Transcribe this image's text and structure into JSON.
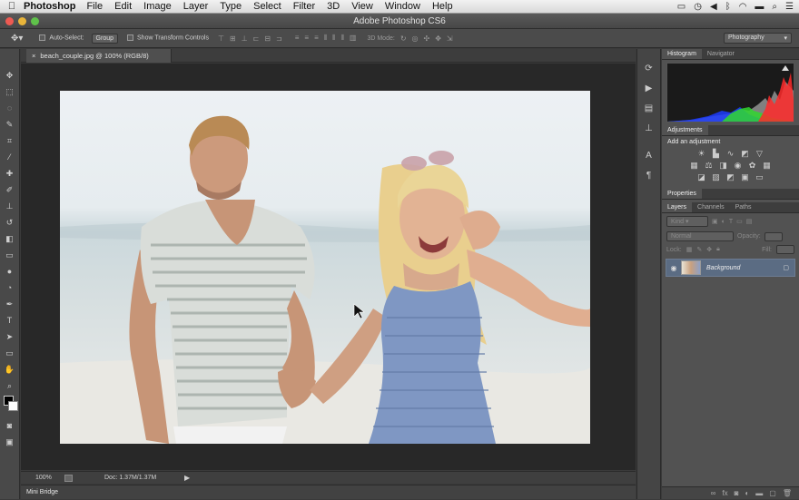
{
  "menubar": {
    "app": "Photoshop",
    "items": [
      "File",
      "Edit",
      "Image",
      "Layer",
      "Type",
      "Select",
      "Filter",
      "3D",
      "View",
      "Window",
      "Help"
    ]
  },
  "window": {
    "title": "Adobe Photoshop CS6"
  },
  "options": {
    "auto_select": "Auto-Select:",
    "group": "Group",
    "show_transform": "Show Transform Controls",
    "mode_3d": "3D Mode:",
    "workspace": "Photography"
  },
  "document": {
    "tab": "beach_couple.jpg @ 100% (RGB/8)",
    "zoom": "100%",
    "doc_info": "Doc: 1.37M/1.37M"
  },
  "mini_bridge": "Mini Bridge",
  "panels": {
    "histogram_tabs": [
      "Histogram",
      "Navigator"
    ],
    "adjustments_title": "Adjustments",
    "add_adjustment": "Add an adjustment",
    "properties_title": "Properties",
    "layers_tabs": [
      "Layers",
      "Channels",
      "Paths"
    ],
    "kind": "Kind",
    "blend": "Normal",
    "opacity_label": "Opacity:",
    "lock_label": "Lock:",
    "fill_label": "Fill:",
    "layer_name": "Background"
  },
  "colors": {
    "accent": "#5b6c83",
    "panel": "#525252"
  }
}
